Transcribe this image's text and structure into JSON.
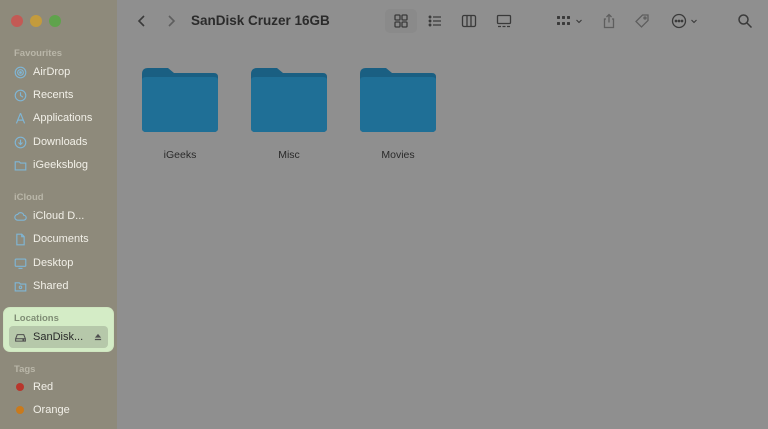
{
  "window": {
    "title": "SanDisk Cruzer 16GB"
  },
  "sidebar": {
    "sections": [
      {
        "key": "favourites",
        "label": "Favourites"
      },
      {
        "key": "icloud",
        "label": "iCloud"
      },
      {
        "key": "locations",
        "label": "Locations"
      },
      {
        "key": "tags",
        "label": "Tags"
      }
    ],
    "favourites": [
      {
        "label": "AirDrop",
        "icon": "airdrop-icon"
      },
      {
        "label": "Recents",
        "icon": "clock-icon"
      },
      {
        "label": "Applications",
        "icon": "applications-icon"
      },
      {
        "label": "Downloads",
        "icon": "download-icon"
      },
      {
        "label": "iGeeksblog",
        "icon": "folder-icon"
      }
    ],
    "icloud": [
      {
        "label": "iCloud D...",
        "icon": "cloud-icon"
      },
      {
        "label": "Documents",
        "icon": "document-icon"
      },
      {
        "label": "Desktop",
        "icon": "desktop-icon"
      },
      {
        "label": "Shared",
        "icon": "shared-folder-icon"
      }
    ],
    "locations": [
      {
        "label": "SanDisk...",
        "icon": "drive-icon",
        "eject_icon": "eject-icon"
      }
    ],
    "tags": [
      {
        "label": "Red",
        "color": "#c0392b"
      },
      {
        "label": "Orange",
        "color": "#d7811d"
      }
    ]
  },
  "toolbar": {
    "icons": [
      "back-icon",
      "forward-icon",
      "icon-view-icon",
      "list-view-icon",
      "column-view-icon",
      "gallery-view-icon",
      "group-icon",
      "share-icon",
      "tag-icon",
      "more-icon",
      "search-icon"
    ]
  },
  "folders": [
    {
      "name": "iGeeks"
    },
    {
      "name": "Misc"
    },
    {
      "name": "Movies"
    }
  ],
  "colors": {
    "folder": "#1f6f96",
    "folder_tab": "#1a5f82",
    "highlight": "#d4ecc6"
  }
}
